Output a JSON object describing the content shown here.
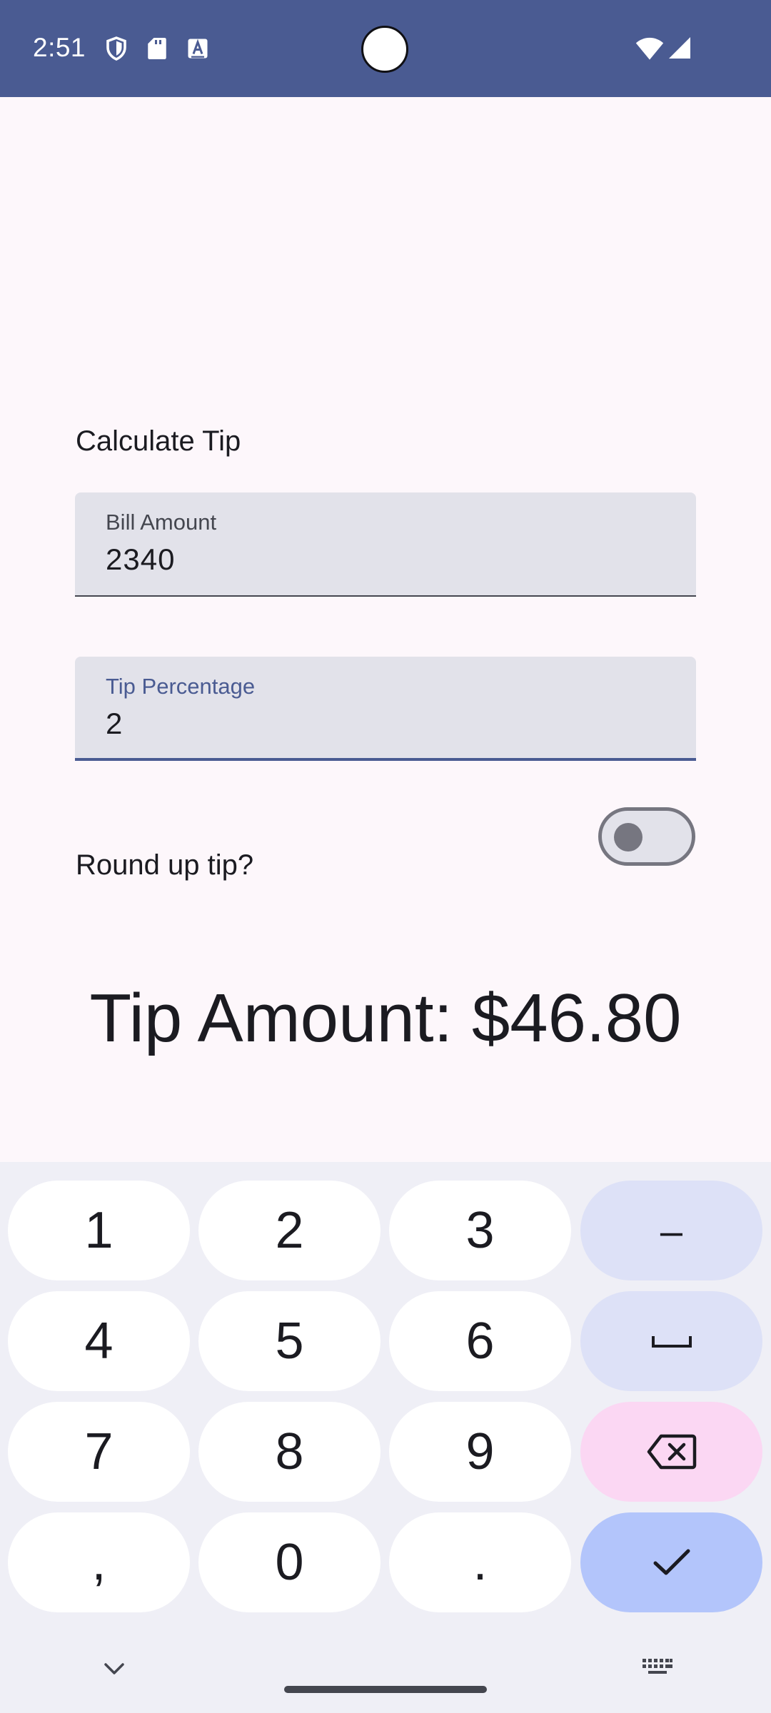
{
  "status_bar": {
    "time": "2:51",
    "color": "#4a5b92",
    "icons": [
      "shield-icon",
      "sd-card-icon",
      "font-icon",
      "wifi-icon",
      "signal-icon"
    ]
  },
  "app": {
    "heading": "Calculate Tip",
    "bill_field": {
      "label": "Bill Amount",
      "value": "2340"
    },
    "tip_field": {
      "label": "Tip Percentage",
      "value": "2"
    },
    "round_up": {
      "label": "Round up tip?",
      "checked": false
    },
    "tip_amount": "Tip Amount: $46.80"
  },
  "keyboard": {
    "keys": {
      "k1": "1",
      "k2": "2",
      "k3": "3",
      "minus": "–",
      "k4": "4",
      "k5": "5",
      "k6": "6",
      "k7": "7",
      "k8": "8",
      "k9": "9",
      "comma": ",",
      "k0": "0",
      "period": "."
    },
    "icons": [
      "space-icon",
      "backspace-icon",
      "checkmark-icon",
      "chevron-down-icon",
      "keyboard-icon"
    ],
    "colors": {
      "function_key": "#dde1f7",
      "delete_key": "#fbd7f3",
      "done_key": "#b3c5fb"
    }
  }
}
